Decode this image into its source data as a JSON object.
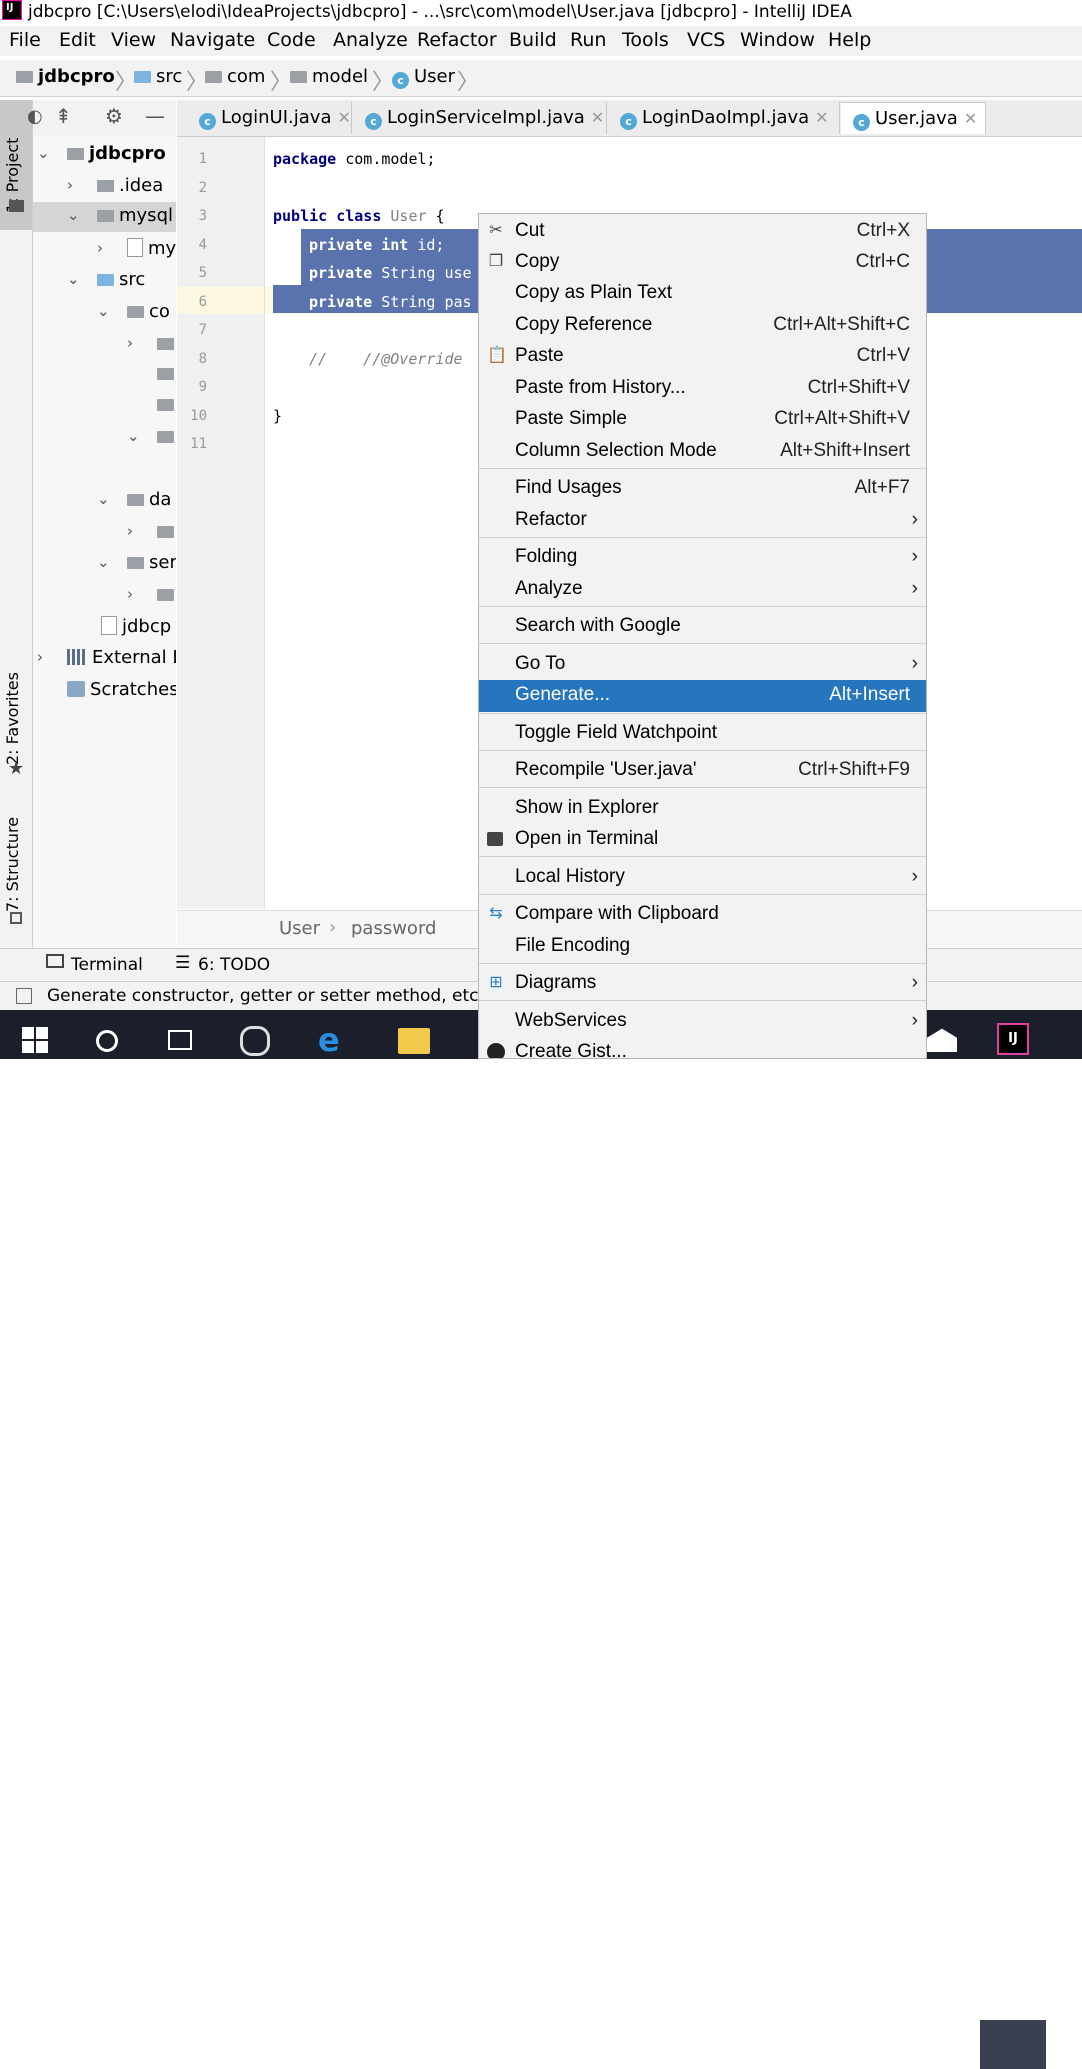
{
  "window": {
    "title": "jdbcpro [C:\\Users\\elodi\\IdeaProjects\\jdbcpro] - ...\\src\\com\\model\\User.java [jdbcpro] - IntelliJ IDEA"
  },
  "menubar": {
    "items": [
      "File",
      "Edit",
      "View",
      "Navigate",
      "Code",
      "Analyze",
      "Refactor",
      "Build",
      "Run",
      "Tools",
      "VCS",
      "Window",
      "Help"
    ]
  },
  "navbar": {
    "crumbs": [
      "jdbcpro",
      "src",
      "com",
      "model",
      "User"
    ]
  },
  "lefttool": {
    "project": "1: Project",
    "favorites": "2: Favorites",
    "structure": "7: Structure"
  },
  "tree": {
    "rows": [
      {
        "label": "jdbcpro"
      },
      {
        "label": ".idea"
      },
      {
        "label": "mysql"
      },
      {
        "label": "my"
      },
      {
        "label": "src"
      },
      {
        "label": "co"
      },
      {
        "label": ""
      },
      {
        "label": ""
      },
      {
        "label": ""
      },
      {
        "label": ""
      },
      {
        "label": "da"
      },
      {
        "label": ""
      },
      {
        "label": "ser"
      },
      {
        "label": ""
      },
      {
        "label": "jdbcp"
      },
      {
        "label": "External L"
      },
      {
        "label": "Scratches"
      }
    ]
  },
  "tabs": [
    "LoginUI.java",
    "LoginServiceImpl.java",
    "LoginDaoImpl.java",
    "User.java"
  ],
  "editor": {
    "lines": [
      "1",
      "2",
      "3",
      "4",
      "5",
      "6",
      "7",
      "8",
      "9",
      "10",
      "11"
    ],
    "code": {
      "l1_kw": "package",
      "l1_rest": " com.model;",
      "l3_kw": "public class",
      "l3_type": " User",
      "l3_rest": " {",
      "l4_kw": "private int",
      "l4_rest": " id;",
      "l5_kw": "private",
      "l5_rest": " String use",
      "l6_kw": "private",
      "l6_rest": " String pas",
      "l8": "//    //@Override",
      "l10": "}"
    }
  },
  "breadcrumb": {
    "class": "User",
    "field": "password"
  },
  "bottomtabs": {
    "terminal": "Terminal",
    "todo": "6: TODO"
  },
  "status": {
    "text": "Generate constructor, getter or setter method, etc."
  },
  "context_menu": {
    "items": [
      {
        "label": "Cut",
        "shortcut": "Ctrl+X"
      },
      {
        "label": "Copy",
        "shortcut": "Ctrl+C"
      },
      {
        "label": "Copy as Plain Text",
        "shortcut": ""
      },
      {
        "label": "Copy Reference",
        "shortcut": "Ctrl+Alt+Shift+C"
      },
      {
        "label": "Paste",
        "shortcut": "Ctrl+V"
      },
      {
        "label": "Paste from History...",
        "shortcut": "Ctrl+Shift+V"
      },
      {
        "label": "Paste Simple",
        "shortcut": "Ctrl+Alt+Shift+V"
      },
      {
        "label": "Column Selection Mode",
        "shortcut": "Alt+Shift+Insert"
      },
      {
        "label": "Find Usages",
        "shortcut": "Alt+F7"
      },
      {
        "label": "Refactor",
        "shortcut": ""
      },
      {
        "label": "Folding",
        "shortcut": ""
      },
      {
        "label": "Analyze",
        "shortcut": ""
      },
      {
        "label": "Search with Google",
        "shortcut": ""
      },
      {
        "label": "Go To",
        "shortcut": ""
      },
      {
        "label": "Generate...",
        "shortcut": "Alt+Insert"
      },
      {
        "label": "Toggle Field Watchpoint",
        "shortcut": ""
      },
      {
        "label": "Recompile 'User.java'",
        "shortcut": "Ctrl+Shift+F9"
      },
      {
        "label": "Show in Explorer",
        "shortcut": ""
      },
      {
        "label": "Open in Terminal",
        "shortcut": ""
      },
      {
        "label": "Local History",
        "shortcut": ""
      },
      {
        "label": "Compare with Clipboard",
        "shortcut": ""
      },
      {
        "label": "File Encoding",
        "shortcut": ""
      },
      {
        "label": "Diagrams",
        "shortcut": ""
      },
      {
        "label": "WebServices",
        "shortcut": ""
      },
      {
        "label": "Create Gist...",
        "shortcut": ""
      }
    ]
  },
  "colors": {
    "selection": "#5a72ad",
    "highlight": "#2675bf",
    "keyword": "#000080"
  }
}
